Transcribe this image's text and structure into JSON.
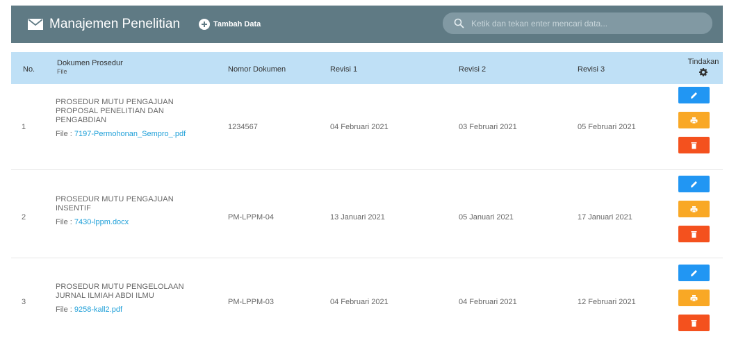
{
  "header": {
    "title": "Manajemen Penelitian",
    "add_label": "Tambah Data",
    "search_placeholder": "Ketik dan tekan enter mencari data..."
  },
  "table": {
    "columns": {
      "no": "No.",
      "doc": "Dokumen Prosedur",
      "doc_sub": "File",
      "nomor": "Nomor Dokumen",
      "r1": "Revisi 1",
      "r2": "Revisi 2",
      "r3": "Revisi 3",
      "actions": "Tindakan"
    },
    "rows": [
      {
        "no": "1",
        "name": "PROSEDUR MUTU PENGAJUAN PROPOSAL PENELITIAN DAN PENGABDIAN",
        "file_prefix": "File : ",
        "file": "7197-Permohonan_Sempro_.pdf",
        "nomor": "1234567",
        "r1": "04 Februari 2021",
        "r2": "03 Februari 2021",
        "r3": "05 Februari 2021"
      },
      {
        "no": "2",
        "name": "PROSEDUR MUTU PENGAJUAN INSENTIF",
        "file_prefix": "File : ",
        "file": "7430-lppm.docx",
        "nomor": "PM-LPPM-04",
        "r1": "13 Januari 2021",
        "r2": "05 Januari 2021",
        "r3": "17 Januari 2021"
      },
      {
        "no": "3",
        "name": "PROSEDUR MUTU PENGELOLAAN JURNAL ILMIAH ABDI ILMU",
        "file_prefix": "File : ",
        "file": "9258-kall2.pdf",
        "nomor": "PM-LPPM-03",
        "r1": "04 Februari 2021",
        "r2": "04 Februari 2021",
        "r3": "12 Februari 2021"
      }
    ]
  },
  "colors": {
    "header_bg": "#5f7a84",
    "thead_bg": "#bfe0f6",
    "edit": "#2196f3",
    "print": "#f9a825",
    "delete": "#f4511e",
    "link": "#1e9fd8"
  },
  "icons": {
    "title": "mail-icon",
    "add": "plus-circle-icon",
    "search": "search-icon",
    "actions": "gear-icon",
    "edit": "pencil-icon",
    "print": "printer-icon",
    "delete": "trash-icon"
  }
}
